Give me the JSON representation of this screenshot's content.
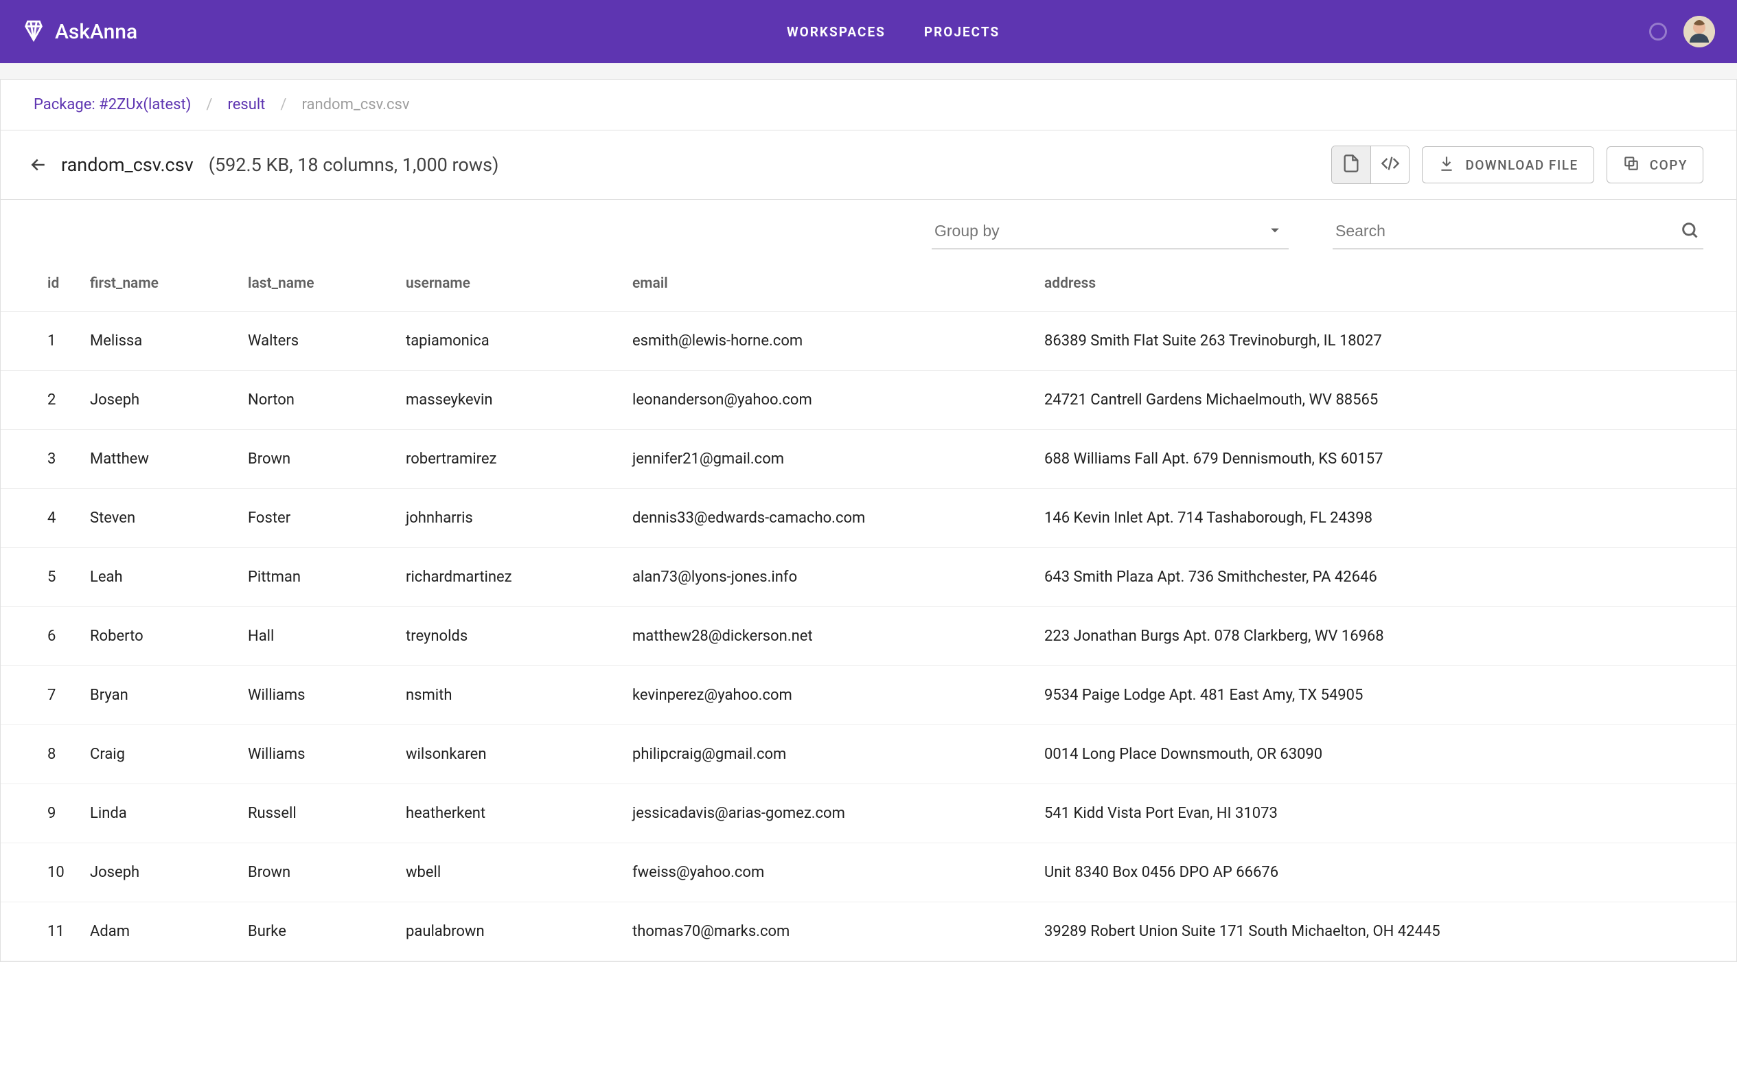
{
  "header": {
    "brand": "AskAnna",
    "nav": {
      "workspaces": "WORKSPACES",
      "projects": "PROJECTS"
    }
  },
  "breadcrumb": {
    "package": "Package: #2ZUx(latest)",
    "result": "result",
    "current": "random_csv.csv"
  },
  "file": {
    "name": "random_csv.csv",
    "meta": "(592.5 KB, 18 columns, 1,000 rows)"
  },
  "actions": {
    "download": "DOWNLOAD FILE",
    "copy": "COPY"
  },
  "controls": {
    "group_by_placeholder": "Group by",
    "search_placeholder": "Search"
  },
  "columns": [
    "id",
    "first_name",
    "last_name",
    "username",
    "email",
    "address"
  ],
  "rows": [
    {
      "id": "1",
      "first_name": "Melissa",
      "last_name": "Walters",
      "username": "tapiamonica",
      "email": "esmith@lewis-horne.com",
      "address": "86389 Smith Flat Suite 263 Trevinoburgh, IL 18027"
    },
    {
      "id": "2",
      "first_name": "Joseph",
      "last_name": "Norton",
      "username": "masseykevin",
      "email": "leonanderson@yahoo.com",
      "address": "24721 Cantrell Gardens Michaelmouth, WV 88565"
    },
    {
      "id": "3",
      "first_name": "Matthew",
      "last_name": "Brown",
      "username": "robertramirez",
      "email": "jennifer21@gmail.com",
      "address": "688 Williams Fall Apt. 679 Dennismouth, KS 60157"
    },
    {
      "id": "4",
      "first_name": "Steven",
      "last_name": "Foster",
      "username": "johnharris",
      "email": "dennis33@edwards-camacho.com",
      "address": "146 Kevin Inlet Apt. 714 Tashaborough, FL 24398"
    },
    {
      "id": "5",
      "first_name": "Leah",
      "last_name": "Pittman",
      "username": "richardmartinez",
      "email": "alan73@lyons-jones.info",
      "address": "643 Smith Plaza Apt. 736 Smithchester, PA 42646"
    },
    {
      "id": "6",
      "first_name": "Roberto",
      "last_name": "Hall",
      "username": "treynolds",
      "email": "matthew28@dickerson.net",
      "address": "223 Jonathan Burgs Apt. 078 Clarkberg, WV 16968"
    },
    {
      "id": "7",
      "first_name": "Bryan",
      "last_name": "Williams",
      "username": "nsmith",
      "email": "kevinperez@yahoo.com",
      "address": "9534 Paige Lodge Apt. 481 East Amy, TX 54905"
    },
    {
      "id": "8",
      "first_name": "Craig",
      "last_name": "Williams",
      "username": "wilsonkaren",
      "email": "philipcraig@gmail.com",
      "address": "0014 Long Place Downsmouth, OR 63090"
    },
    {
      "id": "9",
      "first_name": "Linda",
      "last_name": "Russell",
      "username": "heatherkent",
      "email": "jessicadavis@arias-gomez.com",
      "address": "541 Kidd Vista Port Evan, HI 31073"
    },
    {
      "id": "10",
      "first_name": "Joseph",
      "last_name": "Brown",
      "username": "wbell",
      "email": "fweiss@yahoo.com",
      "address": "Unit 8340 Box 0456 DPO AP 66676"
    },
    {
      "id": "11",
      "first_name": "Adam",
      "last_name": "Burke",
      "username": "paulabrown",
      "email": "thomas70@marks.com",
      "address": "39289 Robert Union Suite 171 South Michaelton, OH 42445"
    }
  ]
}
